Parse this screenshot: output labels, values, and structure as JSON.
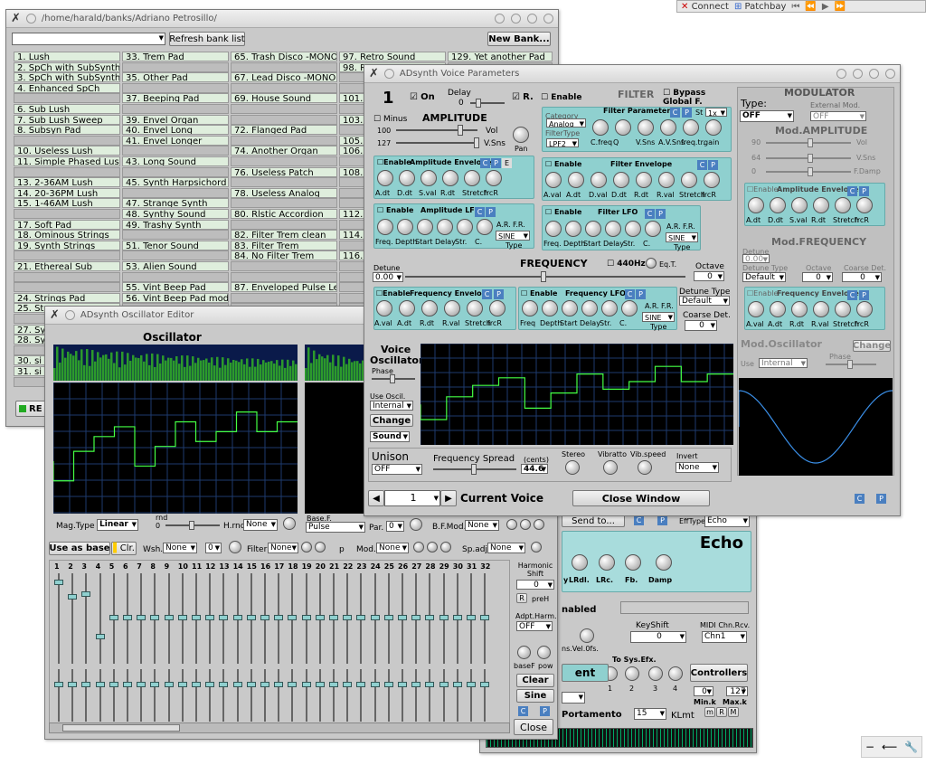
{
  "topbar": {
    "connect": "Connect",
    "patchbay": "Patchbay"
  },
  "bank": {
    "title": "/home/harald/banks/Adriano Petrosillo/",
    "refresh": "Refresh bank list",
    "new_bank": "New Bank...",
    "col1": [
      "1. Lush",
      "2. SpCh with SubSynth",
      "3. SpCh with SubSynth",
      "4. Enhanced SpCh",
      "",
      "6. Sub Lush",
      "7. Sub Lush Sweep",
      "8. Subsyn Pad",
      "",
      "10. Useless Lush",
      "11. Simple Phased Lus",
      "",
      "13. 2-36AM Lush",
      "14. 20-36PM Lush",
      "15. 1-46AM Lush",
      "",
      "17. Soft Pad",
      "18. Ominous Strings",
      "19. Synth Strings",
      "",
      "21. Ethereal Sub",
      "",
      "",
      "24. Strings Pad",
      "25. St",
      "",
      "27. Sy",
      "28. Sy",
      "",
      "30. si",
      "31. si"
    ],
    "col2": [
      "33. Trem Pad",
      "",
      "35. Other Pad",
      "",
      "37. Beeping Pad",
      "",
      "39. Envel Organ",
      "40. Envel Long",
      "41. Envel Longer",
      "",
      "43. Long Sound",
      "",
      "45. Synth Harpsichord",
      "",
      "47. Strange Synth",
      "48. Synthy Sound",
      "49. Trashy Synth",
      "",
      "51. Tenor Sound",
      "",
      "53. Alien Sound",
      "",
      "55. Vint Beep Pad",
      "56. Vint Beep Pad mod"
    ],
    "col3": [
      "65. Trash Disco -MONO",
      "",
      "67. Lead Disco -MONO",
      "",
      "69. House Sound",
      "",
      "",
      "72. Flanged Pad",
      "",
      "74. Another Organ",
      "",
      "76. Useless Patch",
      "",
      "78. Useless Analog",
      "",
      "80. Rlstic Accordion",
      "",
      "82. Filter Trem clean",
      "83. Filter Trem",
      "84. No Filter Trem",
      "",
      "",
      "87. Enveloped Pulse Le"
    ],
    "col4": [
      "97. Retro Sound",
      "98. R",
      "",
      "",
      "101.",
      "",
      "103.",
      "",
      "105.",
      "106.",
      "",
      "108.",
      "",
      "",
      "",
      "112.",
      "",
      "114.",
      "",
      "116."
    ],
    "col5": [
      "129. Yet another Pad"
    ],
    "re": "RE"
  },
  "voice": {
    "title": "ADsynth Voice Parameters",
    "num": "1",
    "on": "On",
    "delay": "Delay",
    "delay_val": "0",
    "r": "R.",
    "amp": {
      "minus": "Minus",
      "title": "AMPLITUDE",
      "vol": "Vol",
      "v100": "100",
      "vsns": "V.Sns",
      "v127": "127",
      "pan": "Pan",
      "env_enable": "Enable",
      "env_title": "Amplitude Envelope",
      "env_labels": [
        "A.dt",
        "D.dt",
        "S.val",
        "R.dt",
        "Stretch",
        "frcR"
      ],
      "lfo_enable": "Enable",
      "lfo_title": "Amplitude LFO",
      "lfo_labels": [
        "Freq.",
        "Depth",
        "Start",
        "Delay",
        "Str.",
        "C."
      ],
      "ar": "A.R.",
      "fr": "F.R.",
      "sine": "SINE",
      "type": "Type"
    },
    "filter": {
      "enable": "Enable",
      "title": "FILTER",
      "bypass": "Bypass Global F.",
      "params": "Filter Parameters",
      "category": "Category",
      "analog": "Analog",
      "st": "St",
      "x1": "1x",
      "filtertype": "FilterType",
      "lpf2": "LPF2",
      "labels": [
        "C.freq",
        "Q",
        "V.Sns",
        "A.V.Sns",
        "freq.tr.",
        "gain"
      ],
      "env_enable": "Enable",
      "env_title": "Filter Envelope",
      "env_labels": [
        "A.val",
        "A.dt",
        "D.val",
        "D.dt",
        "R.dt",
        "R.val",
        "Stretch",
        "frcR"
      ],
      "lfo_enable": "Enable",
      "lfo_title": "Filter LFO",
      "lfo_labels": [
        "Freq.",
        "Depth",
        "Start",
        "Delay",
        "Str.",
        "C."
      ],
      "ar": "A.R.",
      "fr": "F.R.",
      "sine": "SINE",
      "type": "Type"
    },
    "freq": {
      "detune": "Detune",
      "detune_val": "0.00",
      "title": "FREQUENCY",
      "hz440": "440Hz",
      "eqt": "Eq.T.",
      "octave": "Octave",
      "octave_val": "0",
      "env_enable": "Enable",
      "env_title": "Frequency Envelope",
      "env_labels": [
        "A.val",
        "A.dt",
        "R.dt",
        "R.val",
        "Stretch",
        "frcR"
      ],
      "lfo_enable": "Enable",
      "lfo_title": "Frequency LFO",
      "lfo_labels": [
        "Freq",
        "Depth",
        "Start",
        "Delay",
        "Str.",
        "C."
      ],
      "ar": "A.R.",
      "fr": "F.R.",
      "sine": "SINE",
      "type": "Type",
      "detune_type": "Detune Type",
      "default": "Default",
      "coarse": "Coarse Det.",
      "coarse_val": "0"
    },
    "osc": {
      "title1": "Voice",
      "title2": "Oscillator",
      "phase": "Phase",
      "use": "Use Oscil.",
      "internal": "Internal",
      "change": "Change",
      "sound": "Sound"
    },
    "unison": {
      "title": "Unison",
      "off": "OFF",
      "spread": "Frequency Spread",
      "cents": "(cents)",
      "spread_val": "44.6",
      "stereo": "Stereo",
      "vibratto": "Vibratto",
      "vibspeed": "Vib.speed",
      "invert": "Invert",
      "none": "None"
    },
    "current": {
      "val": "1",
      "label": "Current Voice",
      "close": "Close Window"
    },
    "mod": {
      "title": "MODULATOR",
      "type": "Type:",
      "off": "OFF",
      "ext": "External Mod.",
      "ext_val": "OFF",
      "amp": "Mod.AMPLITUDE",
      "vol": "Vol",
      "v90": "90",
      "vsns": "V.Sns",
      "v64": "64",
      "fdamp": "F.Damp",
      "v0": "0",
      "env_enable": "Enable",
      "env_title": "Amplitude Envelope",
      "env_labels": [
        "A.dt",
        "D.dt",
        "S.val",
        "R.dt",
        "Stretch",
        "frcR"
      ],
      "freq": "Mod.FREQUENCY",
      "detune": "Detune",
      "detune_val": "0.00",
      "dtype": "Detune Type",
      "default": "Default",
      "octave": "Octave",
      "ov": "0",
      "coarse": "Coarse Det.",
      "cv": "0",
      "fenv_enable": "Enable",
      "fenv_title": "Frequency Envelope",
      "fenv_labels": [
        "A.val",
        "A.dt",
        "R.dt",
        "R.val",
        "Stretch",
        "frcR"
      ],
      "osc": "Mod.Oscillator",
      "change": "Change",
      "use": "Use",
      "internal": "Internal",
      "phase": "Phase"
    },
    "cp": [
      "C",
      "P"
    ]
  },
  "oscwin": {
    "title": "ADsynth Oscillator Editor",
    "heading": "Oscillator",
    "magtype": "Mag.Type",
    "linear": "Linear",
    "rnd": "rnd",
    "rnd_val": "0",
    "hrnd": "H.rnd",
    "none": "None",
    "basef": "Base.F.",
    "pulse": "Pulse",
    "par": "Par.",
    "par_val": "0",
    "bfmod": "B.F.Mod.",
    "use_base": "Use as base",
    "clr": "Clr.",
    "wsh": "Wsh.",
    "wsh_val": "0",
    "filter": "Filter",
    "p": "p",
    "mod": "Mod.",
    "spadj": "Sp.adj.",
    "harm_shift": "Harmonic Shift",
    "hs_val": "0",
    "r": "R",
    "preh": "preH",
    "adpt": "Adpt.Harm.",
    "adpt_val": "OFF",
    "basef2": "baseF",
    "pow": "pow",
    "clear": "Clear",
    "sine": "Sine",
    "close": "Close",
    "harmonics": [
      "1",
      "2",
      "3",
      "4",
      "5",
      "6",
      "7",
      "8",
      "9",
      "10",
      "11",
      "12",
      "13",
      "14",
      "15",
      "16",
      "17",
      "18",
      "19",
      "20",
      "21",
      "22",
      "23",
      "24",
      "25",
      "26",
      "27",
      "28",
      "29",
      "30",
      "31",
      "32"
    ],
    "harm_levels": [
      0.08,
      0.25,
      0.22,
      0.73,
      0.5,
      0.5,
      0.5,
      0.5,
      0.5,
      0.5,
      0.5,
      0.5,
      0.5,
      0.5,
      0.5,
      0.5,
      0.5,
      0.5,
      0.5,
      0.5,
      0.5,
      0.5,
      0.5,
      0.5,
      0.5,
      0.5,
      0.5,
      0.5,
      0.5,
      0.5,
      0.5,
      0.5
    ]
  },
  "efx": {
    "send": "Send to...",
    "efftype": "EffType",
    "echo_sel": "Echo",
    "echo": "Echo",
    "knobs": [
      "y",
      "LRdl.",
      "LRc.",
      "Fb.",
      "Damp"
    ],
    "enabled": "nabled",
    "keyshift": "KeyShift",
    "ks_val": "0",
    "midi": "MIDI Chn.Rcv.",
    "chn": "Chn1",
    "ins": "ns.Vel.0fs.",
    "tosys": "To Sys.Efx.",
    "sys": [
      "1",
      "2",
      "3",
      "4"
    ],
    "controllers": "Controllers",
    "ent": "ent",
    "mink": "Min.k",
    "maxk": "Max.k",
    "mink_val": "0",
    "maxk_val": "127",
    "m": "m",
    "r": "R",
    "mm": "M",
    "portamento": "Portamento",
    "klmt_val": "15",
    "klmt": "KLmt"
  },
  "tray": {
    "minus": "−",
    "arrow": "⟵",
    "wrench": "🔧"
  }
}
